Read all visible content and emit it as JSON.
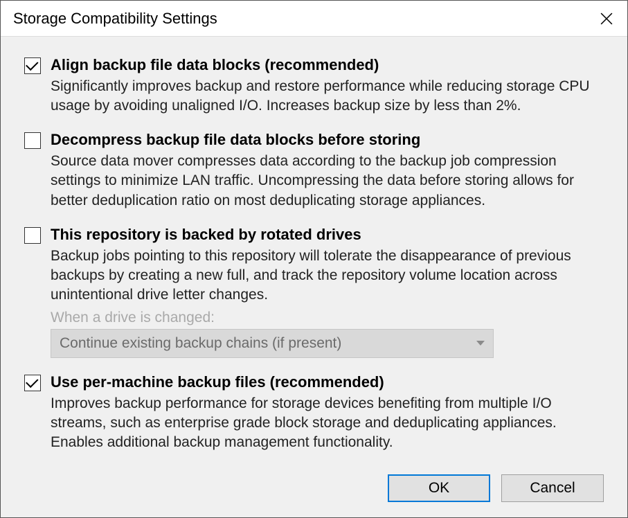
{
  "title": "Storage Compatibility Settings",
  "options": {
    "align": {
      "checked": true,
      "title": "Align backup file data blocks (recommended)",
      "desc": "Significantly improves backup and restore performance while reducing storage CPU usage by avoiding unaligned I/O. Increases backup size by less than 2%."
    },
    "decompress": {
      "checked": false,
      "title": "Decompress backup file data blocks before storing",
      "desc": "Source data mover compresses data according to the backup job compression settings to minimize LAN traffic. Uncompressing the data before storing allows for better deduplication ratio on most deduplicating storage appliances."
    },
    "rotated": {
      "checked": false,
      "title": "This repository is backed by rotated drives",
      "desc": "Backup jobs pointing to this repository will tolerate the disappearance of previous backups by creating a new full, and track the repository volume location across unintentional drive letter changes.",
      "sub_label": "When a drive is changed:",
      "dropdown_value": "Continue existing backup chains (if present)"
    },
    "permachine": {
      "checked": true,
      "title": "Use per-machine backup files (recommended)",
      "desc": "Improves backup performance for storage devices benefiting from multiple I/O streams, such as enterprise grade block storage and deduplicating appliances. Enables additional backup management functionality."
    }
  },
  "buttons": {
    "ok": "OK",
    "cancel": "Cancel"
  }
}
